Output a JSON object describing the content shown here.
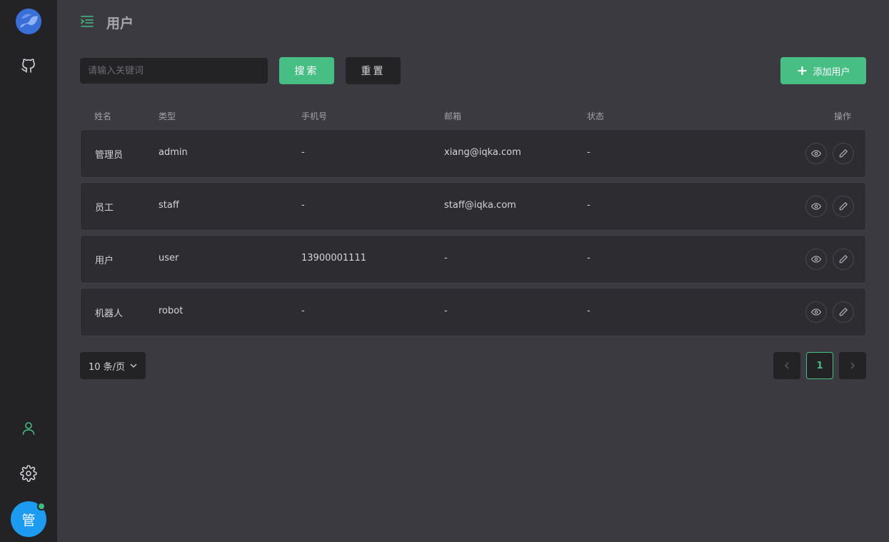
{
  "header": {
    "title": "用户"
  },
  "toolbar": {
    "search_placeholder": "请输入关键词",
    "search_label": "搜索",
    "reset_label": "重置",
    "add_label": "添加用户",
    "add_icon": "+"
  },
  "table": {
    "columns": [
      "姓名",
      "类型",
      "手机号",
      "邮箱",
      "状态",
      "操作"
    ],
    "rows": [
      {
        "name": "管理员",
        "type": "admin",
        "phone": "-",
        "email": "xiang@iqka.com",
        "status": "-"
      },
      {
        "name": "员工",
        "type": "staff",
        "phone": "-",
        "email": "staff@iqka.com",
        "status": "-"
      },
      {
        "name": "用户",
        "type": "user",
        "phone": "13900001111",
        "email": "-",
        "status": "-"
      },
      {
        "name": "机器人",
        "type": "robot",
        "phone": "-",
        "email": "-",
        "status": "-"
      }
    ]
  },
  "pagination": {
    "page_size_label": "10 条/页",
    "current_page": "1"
  },
  "user": {
    "avatar_text": "管"
  },
  "colors": {
    "accent": "#46be84",
    "sidebar": "#232326",
    "background": "#3b3a40",
    "avatar": "#1d9bf0"
  }
}
